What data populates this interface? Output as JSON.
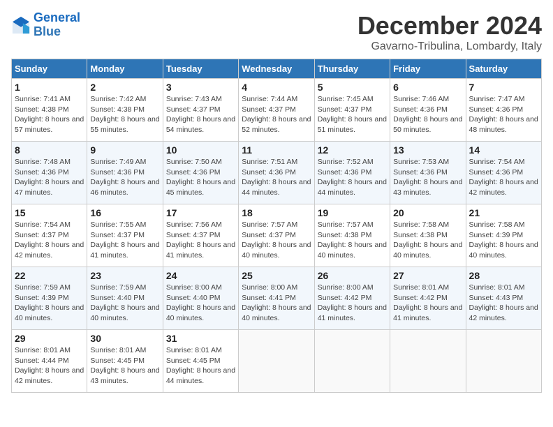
{
  "logo": {
    "line1": "General",
    "line2": "Blue"
  },
  "title": "December 2024",
  "location": "Gavarno-Tribulina, Lombardy, Italy",
  "headers": [
    "Sunday",
    "Monday",
    "Tuesday",
    "Wednesday",
    "Thursday",
    "Friday",
    "Saturday"
  ],
  "weeks": [
    [
      {
        "day": "1",
        "sunrise": "7:41 AM",
        "sunset": "4:38 PM",
        "daylight": "8 hours and 57 minutes."
      },
      {
        "day": "2",
        "sunrise": "7:42 AM",
        "sunset": "4:38 PM",
        "daylight": "8 hours and 55 minutes."
      },
      {
        "day": "3",
        "sunrise": "7:43 AM",
        "sunset": "4:37 PM",
        "daylight": "8 hours and 54 minutes."
      },
      {
        "day": "4",
        "sunrise": "7:44 AM",
        "sunset": "4:37 PM",
        "daylight": "8 hours and 52 minutes."
      },
      {
        "day": "5",
        "sunrise": "7:45 AM",
        "sunset": "4:37 PM",
        "daylight": "8 hours and 51 minutes."
      },
      {
        "day": "6",
        "sunrise": "7:46 AM",
        "sunset": "4:36 PM",
        "daylight": "8 hours and 50 minutes."
      },
      {
        "day": "7",
        "sunrise": "7:47 AM",
        "sunset": "4:36 PM",
        "daylight": "8 hours and 48 minutes."
      }
    ],
    [
      {
        "day": "8",
        "sunrise": "7:48 AM",
        "sunset": "4:36 PM",
        "daylight": "8 hours and 47 minutes."
      },
      {
        "day": "9",
        "sunrise": "7:49 AM",
        "sunset": "4:36 PM",
        "daylight": "8 hours and 46 minutes."
      },
      {
        "day": "10",
        "sunrise": "7:50 AM",
        "sunset": "4:36 PM",
        "daylight": "8 hours and 45 minutes."
      },
      {
        "day": "11",
        "sunrise": "7:51 AM",
        "sunset": "4:36 PM",
        "daylight": "8 hours and 44 minutes."
      },
      {
        "day": "12",
        "sunrise": "7:52 AM",
        "sunset": "4:36 PM",
        "daylight": "8 hours and 44 minutes."
      },
      {
        "day": "13",
        "sunrise": "7:53 AM",
        "sunset": "4:36 PM",
        "daylight": "8 hours and 43 minutes."
      },
      {
        "day": "14",
        "sunrise": "7:54 AM",
        "sunset": "4:36 PM",
        "daylight": "8 hours and 42 minutes."
      }
    ],
    [
      {
        "day": "15",
        "sunrise": "7:54 AM",
        "sunset": "4:37 PM",
        "daylight": "8 hours and 42 minutes."
      },
      {
        "day": "16",
        "sunrise": "7:55 AM",
        "sunset": "4:37 PM",
        "daylight": "8 hours and 41 minutes."
      },
      {
        "day": "17",
        "sunrise": "7:56 AM",
        "sunset": "4:37 PM",
        "daylight": "8 hours and 41 minutes."
      },
      {
        "day": "18",
        "sunrise": "7:57 AM",
        "sunset": "4:37 PM",
        "daylight": "8 hours and 40 minutes."
      },
      {
        "day": "19",
        "sunrise": "7:57 AM",
        "sunset": "4:38 PM",
        "daylight": "8 hours and 40 minutes."
      },
      {
        "day": "20",
        "sunrise": "7:58 AM",
        "sunset": "4:38 PM",
        "daylight": "8 hours and 40 minutes."
      },
      {
        "day": "21",
        "sunrise": "7:58 AM",
        "sunset": "4:39 PM",
        "daylight": "8 hours and 40 minutes."
      }
    ],
    [
      {
        "day": "22",
        "sunrise": "7:59 AM",
        "sunset": "4:39 PM",
        "daylight": "8 hours and 40 minutes."
      },
      {
        "day": "23",
        "sunrise": "7:59 AM",
        "sunset": "4:40 PM",
        "daylight": "8 hours and 40 minutes."
      },
      {
        "day": "24",
        "sunrise": "8:00 AM",
        "sunset": "4:40 PM",
        "daylight": "8 hours and 40 minutes."
      },
      {
        "day": "25",
        "sunrise": "8:00 AM",
        "sunset": "4:41 PM",
        "daylight": "8 hours and 40 minutes."
      },
      {
        "day": "26",
        "sunrise": "8:00 AM",
        "sunset": "4:42 PM",
        "daylight": "8 hours and 41 minutes."
      },
      {
        "day": "27",
        "sunrise": "8:01 AM",
        "sunset": "4:42 PM",
        "daylight": "8 hours and 41 minutes."
      },
      {
        "day": "28",
        "sunrise": "8:01 AM",
        "sunset": "4:43 PM",
        "daylight": "8 hours and 42 minutes."
      }
    ],
    [
      {
        "day": "29",
        "sunrise": "8:01 AM",
        "sunset": "4:44 PM",
        "daylight": "8 hours and 42 minutes."
      },
      {
        "day": "30",
        "sunrise": "8:01 AM",
        "sunset": "4:45 PM",
        "daylight": "8 hours and 43 minutes."
      },
      {
        "day": "31",
        "sunrise": "8:01 AM",
        "sunset": "4:45 PM",
        "daylight": "8 hours and 44 minutes."
      },
      null,
      null,
      null,
      null
    ]
  ]
}
